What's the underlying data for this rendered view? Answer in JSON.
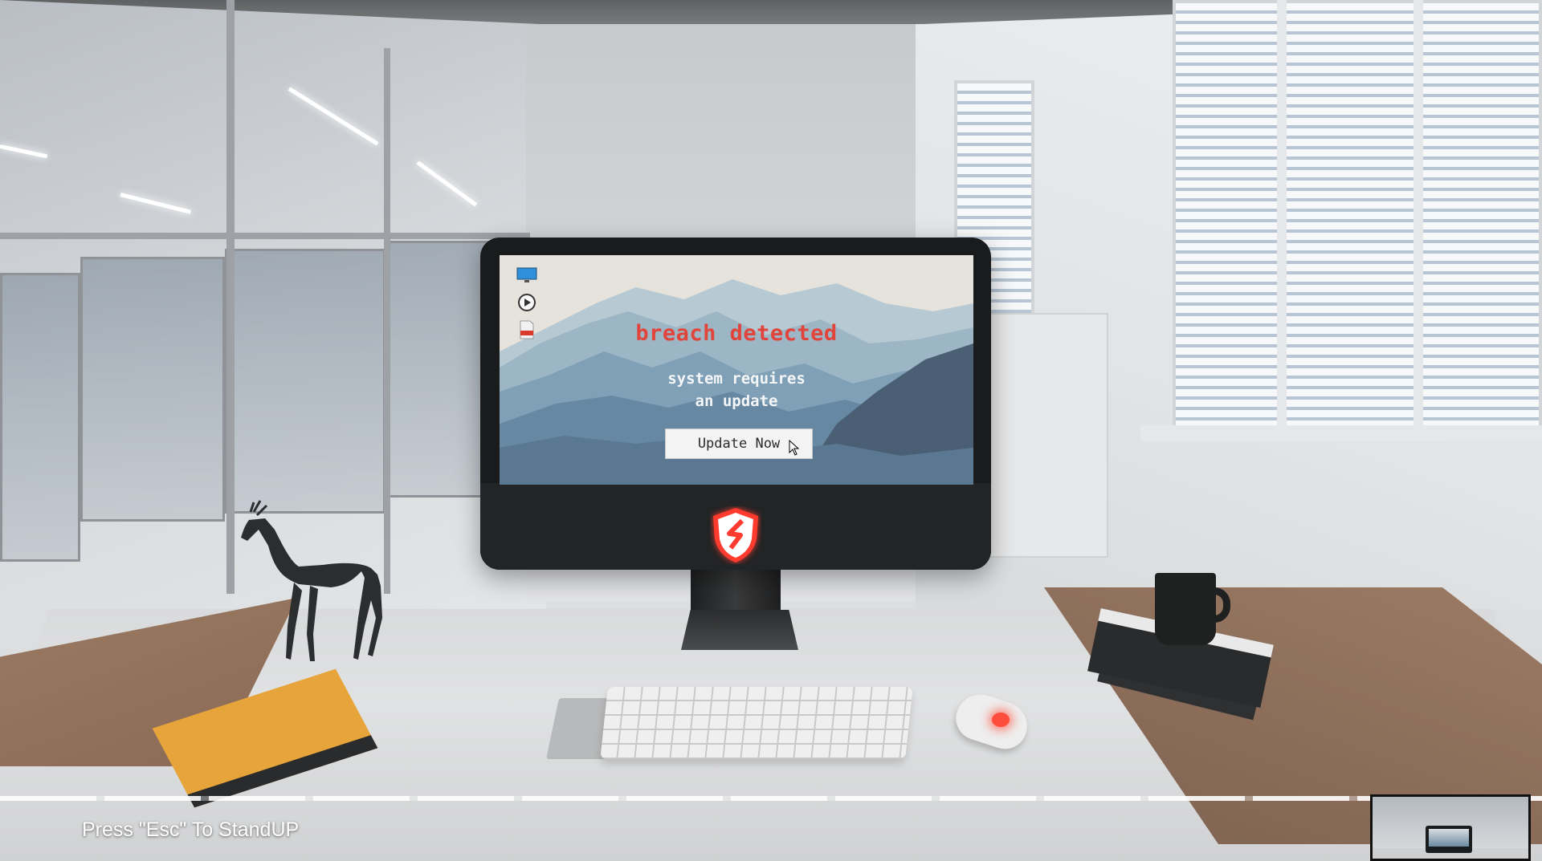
{
  "screen": {
    "title": "breach detected",
    "message_line1": "system requires",
    "message_line2": "an update",
    "button_label": "Update Now",
    "title_color": "#e0443a",
    "desktop_icons": [
      "monitor-icon",
      "play-icon",
      "pdf-file-icon"
    ]
  },
  "hud": {
    "hint": "Press \"Esc\" To StandUP"
  },
  "brand": {
    "logo": "shield-logo-icon",
    "accent": "#e0443a"
  }
}
